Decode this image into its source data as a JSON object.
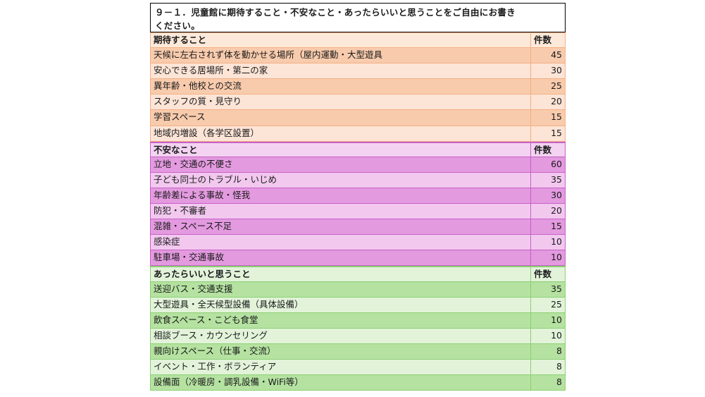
{
  "title": "９－１．児童館に期待すること・不安なこと・あったらいいと思うことをご自由にお書きください。",
  "title_line1": "９－１．児童館に期待すること・不安なこと・あったらいいと思うことをご自由にお書き",
  "title_line2": "ください。",
  "count_header": "件数",
  "sections": [
    {
      "heading": "期待すること",
      "colors": {
        "border": "#f4b084",
        "dark": "#f8cbad",
        "light": "#fce4d6"
      },
      "rows": [
        {
          "label": "天候に左右されず体を動かせる場所（屋内運動・大型遊具",
          "count": "45"
        },
        {
          "label": "安心できる居場所・第二の家",
          "count": "30"
        },
        {
          "label": "異年齢・他校との交流",
          "count": "25"
        },
        {
          "label": "スタッフの質・見守り",
          "count": "20"
        },
        {
          "label": "学習スペース",
          "count": "15"
        },
        {
          "label": "地域内増設（各学区設置）",
          "count": "15"
        }
      ]
    },
    {
      "heading": "不安なこと",
      "colors": {
        "border": "#c860c8",
        "dark": "#e39adf",
        "light": "#f2c8ef"
      },
      "rows": [
        {
          "label": "立地・交通の不便さ",
          "count": "60"
        },
        {
          "label": "子ども同士のトラブル・いじめ",
          "count": "35"
        },
        {
          "label": "年齢差による事故・怪我",
          "count": "30"
        },
        {
          "label": "防犯・不審者",
          "count": "20"
        },
        {
          "label": "混雑・スペース不足",
          "count": "15"
        },
        {
          "label": "感染症",
          "count": "10"
        },
        {
          "label": "駐車場・交通事故",
          "count": "10"
        }
      ]
    },
    {
      "heading": "あったらいいと思うこと",
      "colors": {
        "border": "#8ccf72",
        "dark": "#b5e2a1",
        "light": "#e2f3da"
      },
      "rows": [
        {
          "label": "送迎バス・交通支援",
          "count": "35"
        },
        {
          "label": "大型遊具・全天候型設備（具体設備）",
          "count": "25"
        },
        {
          "label": "飲食スペース・こども食堂",
          "count": "10"
        },
        {
          "label": "相談ブース・カウンセリング",
          "count": "10"
        },
        {
          "label": "親向けスペース（仕事・交流）",
          "count": "8"
        },
        {
          "label": "イベント・工作・ボランティア",
          "count": "8"
        },
        {
          "label": "設備面（冷暖房・調乳設備・WiFi等）",
          "count": "8"
        }
      ]
    }
  ]
}
